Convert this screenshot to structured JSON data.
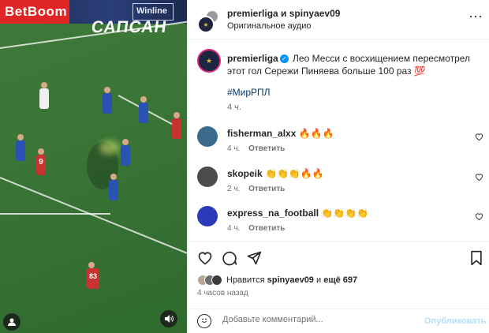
{
  "video": {
    "ads": {
      "betboom": "BetBoom",
      "winline": "Winline",
      "sapsan": "САПСАН"
    },
    "players": [
      {
        "number": "9",
        "team": "red"
      },
      {
        "number": "83",
        "team": "red"
      }
    ],
    "controls": {
      "profile_icon": "person-icon",
      "mute_icon": "speaker-icon"
    }
  },
  "header": {
    "title": "premierliga и spinyaev09",
    "subtitle": "Оригинальное аудио",
    "more_icon": "more-horizontal-icon"
  },
  "caption": {
    "username": "premierliga",
    "verified": true,
    "text": "Лео Месси с восхищением пересмотрел этот гол Сережи Пиняева больше 100 раз 💯",
    "hashtag": "#МирРПЛ",
    "time": "4 ч."
  },
  "comments": [
    {
      "username": "fisherman_alxx",
      "text": "🔥🔥🔥",
      "time": "4 ч.",
      "reply": "Ответить",
      "avatar_color": "#3a6a8c"
    },
    {
      "username": "skopeik",
      "text": "👏👏👏🔥🔥",
      "time": "2 ч.",
      "reply": "Ответить",
      "avatar_color": "#4c4c4c"
    },
    {
      "username": "express_na_football",
      "text": "👏👏👏👏",
      "time": "4 ч.",
      "reply": "Ответить",
      "avatar_color": "#2b3bb8"
    }
  ],
  "actions": {
    "like_icon": "heart-icon",
    "comment_icon": "comment-icon",
    "share_icon": "send-icon",
    "save_icon": "bookmark-icon"
  },
  "likes": {
    "prefix": "Нравится",
    "user": "spinyaev09",
    "conjunction": "и",
    "others": "ещё 697"
  },
  "posted_ago": "4 часов назад",
  "add_comment": {
    "placeholder": "Добавьте комментарий...",
    "post_label": "Опубликовать"
  },
  "colors": {
    "accent": "#0095f6",
    "link": "#00376b",
    "muted": "#737373"
  }
}
